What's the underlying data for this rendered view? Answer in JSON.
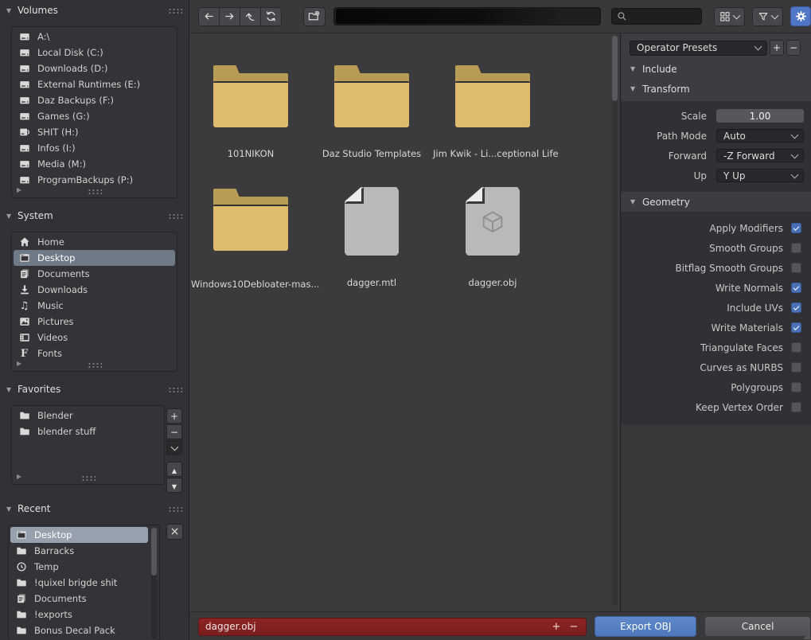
{
  "toolbar": {
    "icons": [
      "back-arrow",
      "forward-arrow",
      "up-arrow",
      "refresh",
      "new-folder",
      "search-magnifier",
      "display-mode-grid",
      "filter-funnel",
      "settings-gear"
    ],
    "path_value": "",
    "search_value": ""
  },
  "sidebar": {
    "volumes": {
      "title": "Volumes",
      "items": [
        {
          "icon": "drive",
          "label": "A:\\"
        },
        {
          "icon": "drive",
          "label": "Local Disk (C:)"
        },
        {
          "icon": "drive",
          "label": "Downloads (D:)"
        },
        {
          "icon": "drive",
          "label": "External Runtimes (E:)"
        },
        {
          "icon": "drive",
          "label": "Daz Backups (F:)"
        },
        {
          "icon": "drive",
          "label": "Games (G:)"
        },
        {
          "icon": "external-drive",
          "label": "SHIT (H:)"
        },
        {
          "icon": "drive",
          "label": "Infos (I:)"
        },
        {
          "icon": "drive",
          "label": "Media (M:)"
        },
        {
          "icon": "drive",
          "label": "ProgramBackups (P:)"
        }
      ]
    },
    "system": {
      "title": "System",
      "items": [
        {
          "icon": "home",
          "label": "Home",
          "selected": false
        },
        {
          "icon": "desktop",
          "label": "Desktop",
          "selected": true
        },
        {
          "icon": "documents",
          "label": "Documents",
          "selected": false
        },
        {
          "icon": "download",
          "label": "Downloads",
          "selected": false
        },
        {
          "icon": "music",
          "label": "Music",
          "selected": false
        },
        {
          "icon": "pictures",
          "label": "Pictures",
          "selected": false
        },
        {
          "icon": "videos",
          "label": "Videos",
          "selected": false
        },
        {
          "icon": "fonts",
          "label": "Fonts",
          "selected": false
        }
      ]
    },
    "favorites": {
      "title": "Favorites",
      "items": [
        {
          "icon": "folder",
          "label": "Blender"
        },
        {
          "icon": "folder",
          "label": "blender stuff"
        }
      ]
    },
    "recent": {
      "title": "Recent",
      "items": [
        {
          "icon": "desktop",
          "label": "Desktop",
          "selected": true
        },
        {
          "icon": "folder",
          "label": "Barracks",
          "selected": false
        },
        {
          "icon": "clock",
          "label": "Temp",
          "selected": false
        },
        {
          "icon": "folder",
          "label": "!quixel brigde shit",
          "selected": false
        },
        {
          "icon": "documents",
          "label": "Documents",
          "selected": false
        },
        {
          "icon": "folder",
          "label": "!exports",
          "selected": false
        },
        {
          "icon": "folder",
          "label": "Bonus Decal Pack",
          "selected": false
        }
      ]
    }
  },
  "files": {
    "items": [
      {
        "type": "folder",
        "name": "101NIKON"
      },
      {
        "type": "folder",
        "name": "Daz Studio Templates"
      },
      {
        "type": "folder",
        "name": "Jim Kwik - Li...ceptional Life"
      },
      {
        "type": "folder",
        "name": "Windows10Debloater-mas..."
      },
      {
        "type": "file",
        "name": "dagger.mtl"
      },
      {
        "type": "file-3d",
        "name": "dagger.obj"
      }
    ]
  },
  "panel": {
    "presets_label": "Operator Presets",
    "include_title": "Include",
    "transform_title": "Transform",
    "geometry_title": "Geometry",
    "transform": {
      "fields": [
        {
          "label": "Scale",
          "value": "1.00",
          "type": "number"
        },
        {
          "label": "Path Mode",
          "value": "Auto",
          "type": "select"
        },
        {
          "label": "Forward",
          "value": "-Z Forward",
          "type": "select"
        },
        {
          "label": "Up",
          "value": "Y Up",
          "type": "select"
        }
      ]
    },
    "geometry": {
      "items": [
        {
          "label": "Apply Modifiers",
          "checked": true
        },
        {
          "label": "Smooth Groups",
          "checked": false
        },
        {
          "label": "Bitflag Smooth Groups",
          "checked": false
        },
        {
          "label": "Write Normals",
          "checked": true
        },
        {
          "label": "Include UVs",
          "checked": true
        },
        {
          "label": "Write Materials",
          "checked": true
        },
        {
          "label": "Triangulate Faces",
          "checked": false
        },
        {
          "label": "Curves as NURBS",
          "checked": false
        },
        {
          "label": "Polygroups",
          "checked": false
        },
        {
          "label": "Keep Vertex Order",
          "checked": false
        }
      ]
    }
  },
  "footer": {
    "filename": "dagger.obj",
    "export_label": "Export OBJ",
    "cancel_label": "Cancel"
  },
  "colors": {
    "accent_blue": "#4f76c7",
    "export_blue": "#5680c2",
    "filename_red": "#8b2222",
    "checkbox_blue": "#4a70b8",
    "folder_body": "#dfbc6d",
    "folder_tab": "#b89b55",
    "selection_grey": "#6e7a87",
    "selection_light": "#96a1ad"
  }
}
